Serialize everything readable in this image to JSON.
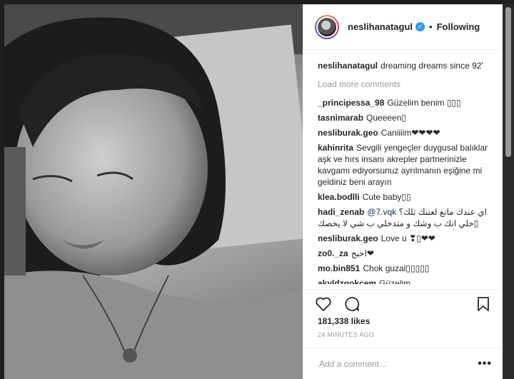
{
  "post": {
    "username": "neslihanatagul",
    "follow_status": "Following",
    "dot": "•",
    "verified_glyph": "✓"
  },
  "caption": {
    "username": "neslihanatagul",
    "text": "dreaming dreams since 92'"
  },
  "load_more": "Load more comments",
  "comments": [
    {
      "user": "_principessa_98",
      "text": "Güzelim benim ▯▯▯"
    },
    {
      "user": "tasnimarab",
      "text": "Queeeen▯"
    },
    {
      "user": "nesliburak.geo",
      "text": "Caniiiim❤❤❤❤"
    },
    {
      "user": "kahinrita",
      "text": "Sevgili yengeçler duygusal balıklar aşk ve hırs insanı akrepler partnerinizle kavgamı ediyorsunuz ayrılmanın eşiğine mi geldiniz beni arayın"
    },
    {
      "user": "klea.bodlli",
      "text": "Cute baby▯▯"
    },
    {
      "user": "hadi_zenab",
      "mention": "@7.vqk",
      "text": "اي عندك مانع لعتنك ثلك؟ خلي انك ب وشك و متدخلي ب شي لا يخصك▯"
    },
    {
      "user": "nesliburak.geo",
      "text": "Love u ❣▯❤❤"
    },
    {
      "user": "zo0._za",
      "text": "احبج❤"
    },
    {
      "user": "mo.bin851",
      "text": "Chok guzal▯▯▯▯▯"
    },
    {
      "user": "akyldzgokcem",
      "text": "Güzelim"
    }
  ],
  "likes": "181,338 likes",
  "timestamp": "24 MINUTES AGO",
  "add_comment_placeholder": "Add a comment...",
  "more_glyph": "•••"
}
